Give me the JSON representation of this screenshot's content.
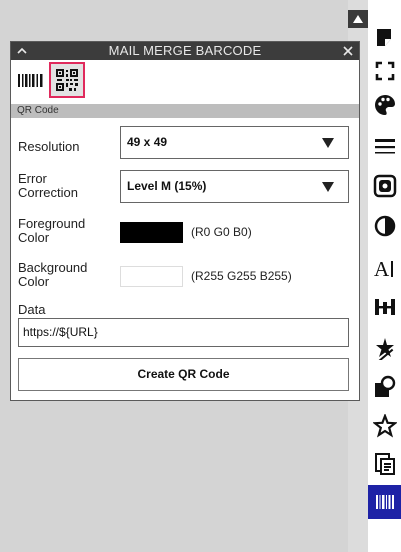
{
  "panel": {
    "title": "MAIL MERGE BARCODE",
    "collapse_icon": "chevron-up-icon",
    "close_icon": "close-icon",
    "barcode_types": [
      {
        "icon": "linear-barcode-icon",
        "selected": false
      },
      {
        "icon": "qr-code-icon",
        "selected": true
      }
    ],
    "section_label": "QR Code",
    "resolution": {
      "label": "Resolution",
      "value": "49 x 49"
    },
    "error_correction": {
      "label": "Error Correction",
      "value": "Level M (15%)"
    },
    "foreground": {
      "label": "Foreground Color",
      "color": "#000000",
      "rgb_text": "(R0 G0 B0)"
    },
    "background": {
      "label": "Background Color",
      "color": "#ffffff",
      "rgb_text": "(R255 G255 B255)"
    },
    "data": {
      "label": "Data",
      "value": "https://${URL}"
    },
    "create_button": "Create QR Code",
    "highlight_color": "#e02a5c"
  },
  "toolbar": {
    "items": [
      {
        "icon": "document-icon"
      },
      {
        "icon": "crop-marks-icon"
      },
      {
        "icon": "palette-icon"
      },
      {
        "icon": "line-styles-icon"
      },
      {
        "icon": "image-frame-icon"
      },
      {
        "icon": "contrast-icon"
      },
      {
        "icon": "text-icon"
      },
      {
        "icon": "align-icon"
      },
      {
        "icon": "effects-star-icon"
      },
      {
        "icon": "shape-fill-icon"
      },
      {
        "icon": "star-outline-icon"
      },
      {
        "icon": "clipboard-document-icon"
      },
      {
        "icon": "barcode-icon",
        "active": true
      }
    ],
    "active_color": "#1e22a6"
  }
}
